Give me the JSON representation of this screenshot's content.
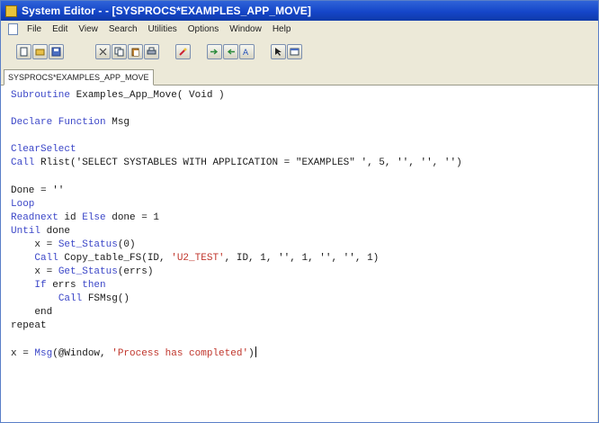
{
  "window": {
    "title": "System Editor - - [SYSPROCS*EXAMPLES_APP_MOVE]"
  },
  "menu": [
    "File",
    "Edit",
    "View",
    "Search",
    "Utilities",
    "Options",
    "Window",
    "Help"
  ],
  "toolbar": {
    "icons": [
      "new-file-icon",
      "open-folder-icon",
      "save-icon",
      "cut-icon",
      "copy-icon",
      "paste-icon",
      "print-icon",
      "run-icon",
      "indent-icon",
      "outdent-icon",
      "find-icon",
      "pointer-icon",
      "dialog-icon"
    ]
  },
  "tab": {
    "label": "SYSPROCS*EXAMPLES_APP_MOVE"
  },
  "code": {
    "l1_kw": "Subroutine",
    "l1_rest": " Examples_App_Move( Void )",
    "l3_kw": "Declare Function",
    "l3_rest": " Msg",
    "l5_kw": "ClearSelect",
    "l6_kw": "Call",
    "l6_rest": " Rlist('SELECT SYSTABLES WITH APPLICATION = \"EXAMPLES\" ', 5, '', '', '')",
    "l8": "Done = ''",
    "l9_kw": "Loop",
    "l10_kw": "Readnext",
    "l10_mid": " id ",
    "l10_kw2": "Else",
    "l10_rest": " done = 1",
    "l11_kw": "Until",
    "l11_rest": " done",
    "l12_pre": "    x = ",
    "l12_fn": "Set_Status",
    "l12_rest": "(0)",
    "l13_pre": "    ",
    "l13_kw": "Call",
    "l13_rest": " Copy_table_FS(ID, ",
    "l13_str": "'U2_TEST'",
    "l13_rest2": ", ID, 1, '', 1, '', '', 1)",
    "l14_pre": "    x = ",
    "l14_fn": "Get_Status",
    "l14_rest": "(errs)",
    "l15_pre": "    ",
    "l15_kw": "If",
    "l15_mid": " errs ",
    "l15_kw2": "then",
    "l16_pre": "        ",
    "l16_kw": "Call",
    "l16_rest": " FSMsg()",
    "l17": "    end",
    "l18": "repeat",
    "l20_pre": "x = ",
    "l20_fn": "Msg",
    "l20_rest": "(@Window, ",
    "l20_str": "'Process has completed'",
    "l20_end": ")"
  }
}
